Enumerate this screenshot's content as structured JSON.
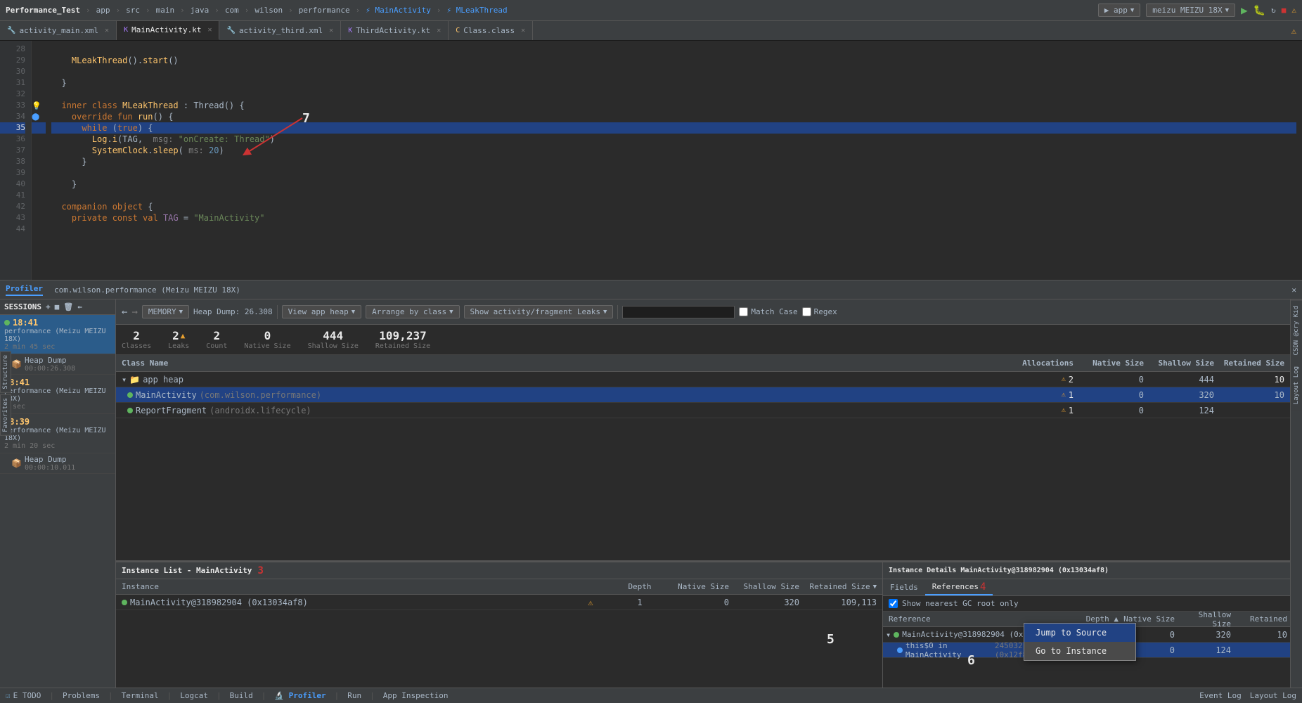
{
  "topbar": {
    "title": "Performance_Test",
    "breadcrumb": [
      "app",
      "src",
      "main",
      "java",
      "com",
      "wilson",
      "performance",
      "MainActivity",
      "MLeakThread"
    ]
  },
  "toolbar_icons": {
    "run": "▶",
    "debug": "🐛",
    "device": "meizu MEIZU 18X"
  },
  "tabs": [
    {
      "id": "activity_main",
      "label": "activity_main.xml",
      "icon": "xml",
      "active": false
    },
    {
      "id": "mainactivity",
      "label": "MainActivity.kt",
      "icon": "kt",
      "active": true
    },
    {
      "id": "activity_third",
      "label": "activity_third.xml",
      "icon": "xml",
      "active": false
    },
    {
      "id": "thirdactivity",
      "label": "ThirdActivity.kt",
      "icon": "kt",
      "active": false
    },
    {
      "id": "class",
      "label": "Class.class",
      "icon": "class",
      "active": false
    }
  ],
  "code": {
    "lines": [
      {
        "num": 28,
        "content": ""
      },
      {
        "num": 29,
        "content": "    MLeakThread().start()"
      },
      {
        "num": 30,
        "content": ""
      },
      {
        "num": 31,
        "content": "  }"
      },
      {
        "num": 32,
        "content": ""
      },
      {
        "num": 33,
        "content": "  inner class MLeakThread : Thread() {",
        "annotation": "💡"
      },
      {
        "num": 34,
        "content": "    override fun run() {",
        "annotation": "🔵"
      },
      {
        "num": 35,
        "content": "      while (true) {",
        "highlighted": true
      },
      {
        "num": 36,
        "content": "        Log.i(TAG,  msg: \"onCreate: Thread\")"
      },
      {
        "num": 37,
        "content": "        SystemClock.sleep( ms: 20)"
      },
      {
        "num": 38,
        "content": "      }"
      },
      {
        "num": 39,
        "content": ""
      },
      {
        "num": 40,
        "content": "    }"
      },
      {
        "num": 41,
        "content": ""
      },
      {
        "num": 42,
        "content": "  companion object {"
      },
      {
        "num": 43,
        "content": "    private const val TAG = \"MainActivity\""
      },
      {
        "num": 44,
        "content": ""
      }
    ],
    "arrow_label": "7"
  },
  "profiler": {
    "tab_label": "Profiler",
    "session_label": "com.wilson.performance (Meizu MEIZU 18X)",
    "sessions_header": "SESSIONS",
    "memory_label": "MEMORY",
    "heap_dump_label": "Heap Dump: 26.308",
    "sessions": [
      {
        "time": "18:41",
        "active": true,
        "dot": true,
        "name": "performance (Meizu MEIZU 18X)",
        "duration": "2 min 45 sec",
        "heap_dump": {
          "label": "Heap Dump",
          "time": "00:00:26.308"
        }
      },
      {
        "time": "18:41",
        "active": false,
        "name": "performance (Meizu MEIZU 18X)",
        "duration": "3 sec"
      },
      {
        "time": "18:39",
        "active": false,
        "name": "performance (Meizu MEIZU 18X)",
        "duration": "2 min 20 sec",
        "heap_dump": {
          "label": "Heap Dump",
          "time": "00:00:10.011"
        }
      }
    ],
    "toolbar": {
      "view_heap": "View app heap",
      "arrange": "Arrange by class",
      "filter": "Show activity/fragment Leaks",
      "search_placeholder": "",
      "match_case": "Match Case",
      "regex": "Regex"
    },
    "stats": {
      "classes_val": "2",
      "classes_label": "Classes",
      "leaks_val": "2",
      "leaks_label": "Leaks",
      "count_val": "2",
      "count_label": "Count",
      "native_val": "0",
      "native_label": "Native Size",
      "shallow_val": "444",
      "shallow_label": "Shallow Size",
      "retained_val": "109,237",
      "retained_label": "Retained Size"
    },
    "class_table": {
      "headers": [
        "Class Name",
        "Allocations",
        "Native Size",
        "Shallow Size",
        "Retained Size"
      ],
      "rows": [
        {
          "type": "group",
          "name": "app heap",
          "icon": "folder",
          "allocations": "2",
          "native": "0",
          "shallow": "444",
          "retained": "10",
          "warning": true,
          "warning_count": "2"
        },
        {
          "type": "class",
          "name": "MainActivity",
          "subname": "(com.wilson.performance)",
          "allocations": "1",
          "native": "0",
          "shallow": "320",
          "retained": "10",
          "warning": true,
          "warning_count": "1",
          "selected": true
        },
        {
          "type": "class",
          "name": "ReportFragment",
          "subname": "(androidx.lifecycle)",
          "allocations": "1",
          "native": "0",
          "shallow": "124",
          "retained": "",
          "warning": true,
          "warning_count": "1"
        }
      ]
    },
    "instance_list": {
      "title": "Instance List - MainActivity",
      "number_annotation": "3",
      "headers": [
        "Instance",
        "Depth",
        "Native Size",
        "Shallow Size",
        "Retained Size"
      ],
      "rows": [
        {
          "name": "MainActivity@318982904 (0x13034af8)",
          "depth": "1",
          "native": "0",
          "shallow": "320",
          "retained": "109,113",
          "warning": true
        }
      ]
    },
    "instance_details": {
      "title": "Instance Details  MainActivity@318982904 (0x13034af8)",
      "tabs": [
        "Fields",
        "References"
      ],
      "active_tab": "References",
      "tab_number": "4",
      "show_nearest_gc": "Show nearest GC root only",
      "gc_checked": true,
      "ref_headers": [
        "Reference",
        "Depth ▲",
        "Native Size",
        "Shallow Size",
        "Retained"
      ],
      "rows": [
        {
          "type": "parent",
          "expanded": true,
          "icon": "green",
          "name": "MainActivity@318982904 (0x1303af8)",
          "depth": "1",
          "native": "0",
          "shallow": "320",
          "retained": "10",
          "warning": false
        },
        {
          "type": "child",
          "icon": "blue",
          "name": "this$0 in MainActivity",
          "addr": "245032 (0x12f808...",
          "depth": "0",
          "native": "0",
          "shallow": "124",
          "retained": "",
          "selected": true
        }
      ],
      "context_menu": {
        "items": [
          {
            "label": "Jump to Source",
            "highlighted": true
          },
          {
            "label": "Go to Instance"
          }
        ]
      }
    }
  },
  "statusbar": {
    "todo": "E TODO",
    "problems": "Problems",
    "terminal": "Terminal",
    "logcat": "Logcat",
    "build": "Build",
    "profiler": "Profiler",
    "run": "Run",
    "app_inspection": "App Inspection",
    "right": {
      "event_log": "Event Log",
      "layout_log": "Layout Log"
    }
  }
}
